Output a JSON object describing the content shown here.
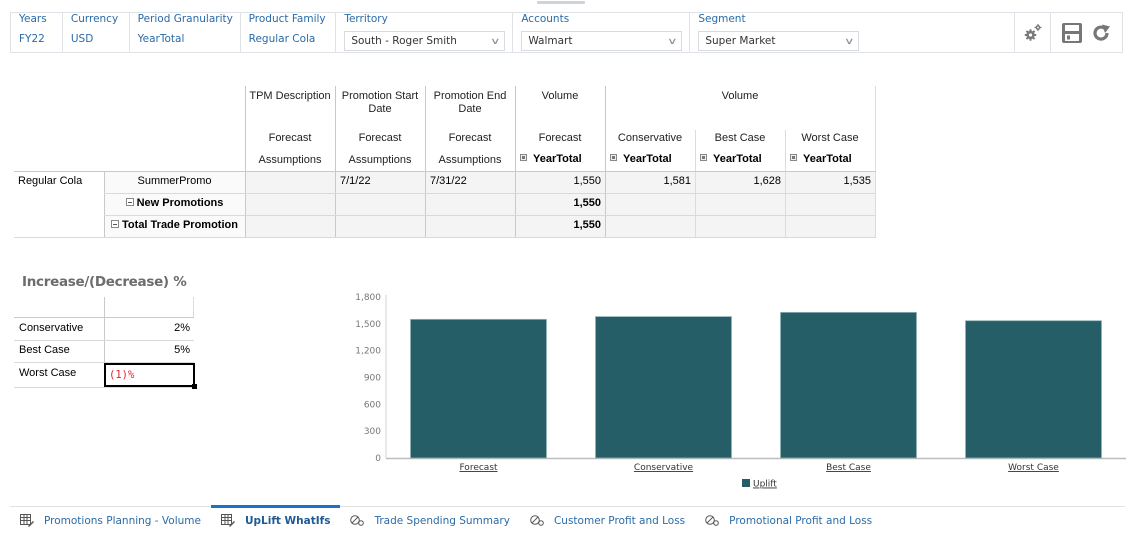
{
  "pov": [
    {
      "label": "Years",
      "value": "FY22",
      "type": "static"
    },
    {
      "label": "Currency",
      "value": "USD",
      "type": "static"
    },
    {
      "label": "Period Granularity",
      "value": "YearTotal",
      "type": "static"
    },
    {
      "label": "Product Family",
      "value": "Regular Cola",
      "type": "static"
    },
    {
      "label": "Territory",
      "value": "South - Roger Smith",
      "type": "select"
    },
    {
      "label": "Accounts",
      "value": "Walmart",
      "type": "select"
    },
    {
      "label": "Segment",
      "value": "Super Market",
      "type": "select"
    }
  ],
  "toolbar": {
    "settings_icon": "gears-icon",
    "save_icon": "save-icon",
    "refresh_icon": "refresh-icon"
  },
  "grid": {
    "col_headers": {
      "row1": [
        "TPM Description",
        "Promotion Start Date",
        "Promotion End Date",
        "Volume",
        "Volume"
      ],
      "row2": [
        "Forecast",
        "Forecast",
        "Forecast",
        "Forecast",
        "Conservative",
        "Best Case",
        "Worst Case"
      ],
      "row3": [
        "Assumptions",
        "Assumptions",
        "Assumptions",
        "YearTotal",
        "YearTotal",
        "YearTotal",
        "YearTotal"
      ]
    },
    "rows": [
      {
        "dim1": "Regular Cola",
        "dim2": "SummerPromo",
        "cells": [
          "",
          "7/1/22",
          "7/31/22",
          "1,550",
          "1,581",
          "1,628",
          "1,535"
        ],
        "bold": false
      },
      {
        "dim1": "",
        "dim2": "New Promotions",
        "cells": [
          "",
          "",
          "",
          "1,550",
          "",
          "",
          ""
        ],
        "bold": true
      },
      {
        "dim1": "",
        "dim2": "Total Trade Promotion",
        "cells": [
          "",
          "",
          "",
          "1,550",
          "",
          "",
          ""
        ],
        "bold": true
      }
    ]
  },
  "incdec": {
    "title": "Increase/(Decrease) %",
    "rows": [
      {
        "label": "Conservative",
        "value": "2%"
      },
      {
        "label": "Best Case",
        "value": "5%"
      },
      {
        "label": "Worst Case",
        "value": "(1)%"
      }
    ]
  },
  "chart_data": {
    "type": "bar",
    "title": "",
    "xlabel": "",
    "ylabel": "",
    "categories": [
      "Forecast",
      "Conservative",
      "Best Case",
      "Worst Case"
    ],
    "series": [
      {
        "name": "Uplift",
        "values": [
          1550,
          1581,
          1628,
          1535
        ],
        "color": "#255e66"
      }
    ],
    "ylim": [
      0,
      1800
    ],
    "yticks": [
      0,
      300,
      600,
      900,
      1200,
      1500,
      1800
    ],
    "ytick_labels": [
      "0",
      "300",
      "600",
      "900",
      "1,200",
      "1,500",
      "1,800"
    ],
    "grid": false,
    "legend": "bottom-center"
  },
  "tabs": [
    {
      "label": "Promotions Planning - Volume",
      "icon": "form-edit-icon",
      "active": false
    },
    {
      "label": "UpLift WhatIfs",
      "icon": "form-edit-icon",
      "active": true
    },
    {
      "label": "Trade Spending Summary",
      "icon": "dashboard-icon",
      "active": false
    },
    {
      "label": "Customer Profit and Loss",
      "icon": "dashboard-icon",
      "active": false
    },
    {
      "label": "Promotional Profit and Loss",
      "icon": "dashboard-icon",
      "active": false
    }
  ]
}
